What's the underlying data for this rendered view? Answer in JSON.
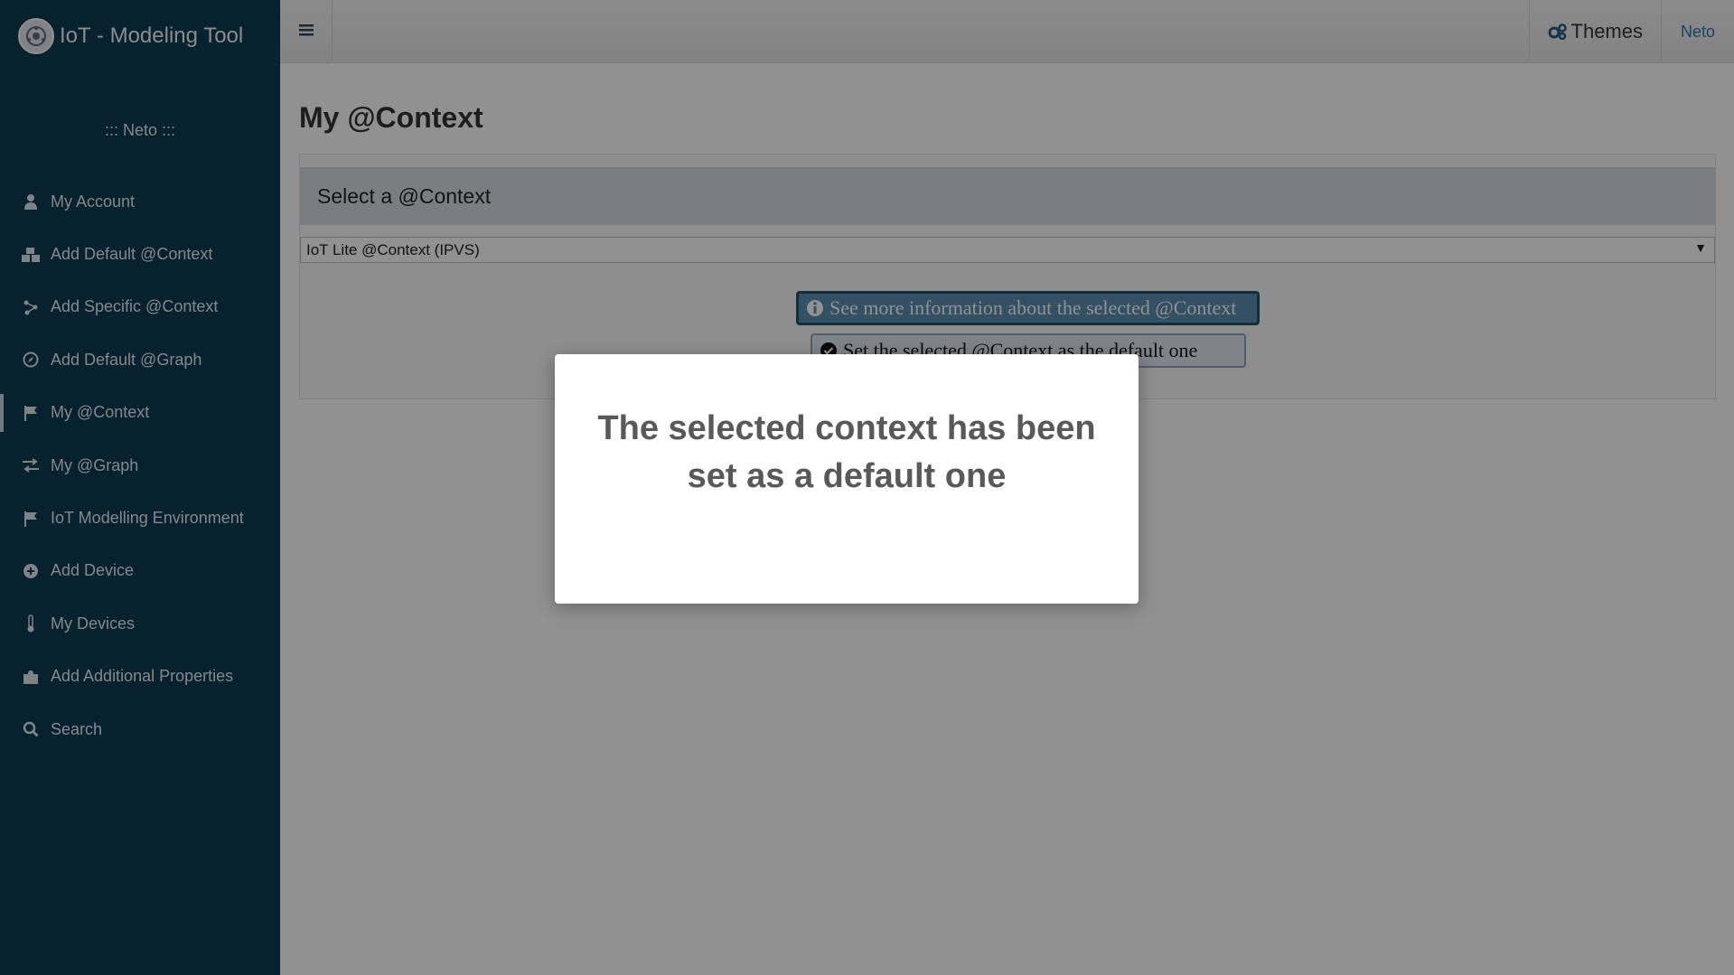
{
  "app": {
    "title": "IoT - Modeling Tool",
    "logo_icon": "gear-network-icon"
  },
  "sidebar": {
    "user_line": "::: Neto :::",
    "items": [
      {
        "label": "My Account",
        "icon": "user-icon"
      },
      {
        "label": "Add Default @Context",
        "icon": "cubes-icon"
      },
      {
        "label": "Add Specific @Context",
        "icon": "sitemap-icon"
      },
      {
        "label": "Add Default @Graph",
        "icon": "compass-icon"
      },
      {
        "label": "My @Context",
        "icon": "flag-icon",
        "active": true
      },
      {
        "label": "My @Graph",
        "icon": "exchange-icon"
      },
      {
        "label": "IoT Modelling Environment",
        "icon": "flag-icon"
      },
      {
        "label": "Add Device",
        "icon": "plus-circle-icon"
      },
      {
        "label": "My Devices",
        "icon": "thermometer-icon"
      },
      {
        "label": "Add Additional Properties",
        "icon": "puzzle-icon"
      },
      {
        "label": "Search",
        "icon": "search-icon"
      }
    ]
  },
  "topbar": {
    "themes_label": "Themes",
    "user_label": "Neto"
  },
  "main": {
    "page_title": "My @Context",
    "panel_title": "Select a @Context",
    "select_value": "IoT Lite @Context (IPVS)",
    "info_button": "See more information about the selected @Context",
    "default_button": "Set the selected @Context as the default one"
  },
  "modal": {
    "message": "The selected context has been set as a default one"
  },
  "colors": {
    "sidebar": "#0d3a52",
    "overlay": "rgba(0,0,0,0.43)",
    "info_button": "#5a8db0"
  }
}
